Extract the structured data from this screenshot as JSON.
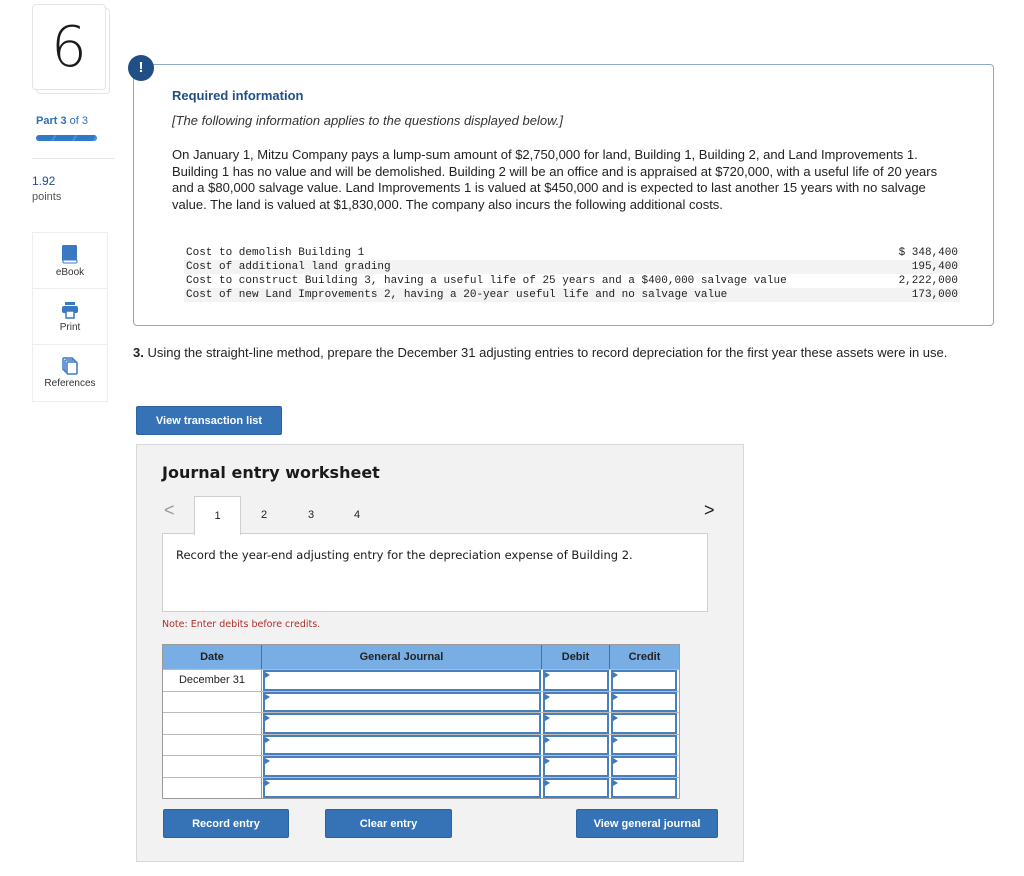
{
  "sidebar": {
    "question_number": "6",
    "part_label": "Part",
    "part_current": "3",
    "part_of": "of 3",
    "part_progress": 1.0,
    "points_value": "1.92",
    "points_label": "points",
    "tools": [
      {
        "label": "eBook",
        "icon": "book-icon"
      },
      {
        "label": "Print",
        "icon": "printer-icon"
      },
      {
        "label": "References",
        "icon": "copy-documents-icon"
      }
    ]
  },
  "required_info": {
    "alert_glyph": "!",
    "title": "Required information",
    "subtitle": "[The following information applies to the questions displayed below.]",
    "body": "On January 1, Mitzu Company pays a lump-sum amount of $2,750,000 for land, Building 1, Building 2, and Land Improvements 1. Building 1 has no value and will be demolished. Building 2 will be an office and is appraised at $720,000, with a useful life of 20 years and a $80,000 salvage value. Land Improvements 1 is valued at $450,000 and is expected to last another 15 years with no salvage value. The land is valued at $1,830,000. The company also incurs the following additional costs.",
    "costs": [
      {
        "description": "Cost to demolish Building 1",
        "amount": "$ 348,400"
      },
      {
        "description": "Cost of additional land grading",
        "amount": "195,400"
      },
      {
        "description": "Cost to construct Building 3, having a useful life of 25 years and a $400,000 salvage value",
        "amount": "2,222,000"
      },
      {
        "description": "Cost of new Land Improvements 2, having a 20-year useful life and no salvage value",
        "amount": "173,000"
      }
    ]
  },
  "question": {
    "number": "3.",
    "text": " Using the straight-line method, prepare the December 31 adjusting entries to record depreciation for the first year these assets were in use."
  },
  "buttons": {
    "view_transaction_list": "View transaction list",
    "record_entry": "Record entry",
    "clear_entry": "Clear entry",
    "view_general_journal": "View general journal"
  },
  "worksheet": {
    "title": "Journal entry worksheet",
    "prev_glyph": "<",
    "next_glyph": ">",
    "tabs": [
      "1",
      "2",
      "3",
      "4"
    ],
    "active_tab": "1",
    "instruction": "Record the year-end adjusting entry for the depreciation expense of Building 2.",
    "note": "Note: Enter debits before credits.",
    "columns": [
      "Date",
      "General Journal",
      "Debit",
      "Credit"
    ],
    "rows": [
      {
        "date": "December 31",
        "account": "",
        "debit": "",
        "credit": ""
      },
      {
        "date": "",
        "account": "",
        "debit": "",
        "credit": ""
      },
      {
        "date": "",
        "account": "",
        "debit": "",
        "credit": ""
      },
      {
        "date": "",
        "account": "",
        "debit": "",
        "credit": ""
      },
      {
        "date": "",
        "account": "",
        "debit": "",
        "credit": ""
      },
      {
        "date": "",
        "account": "",
        "debit": "",
        "credit": ""
      }
    ]
  },
  "colors": {
    "brand_blue": "#3673b6",
    "heading_navy": "#1f4f86",
    "table_header": "#78aee4",
    "note_red": "#b0302a"
  }
}
